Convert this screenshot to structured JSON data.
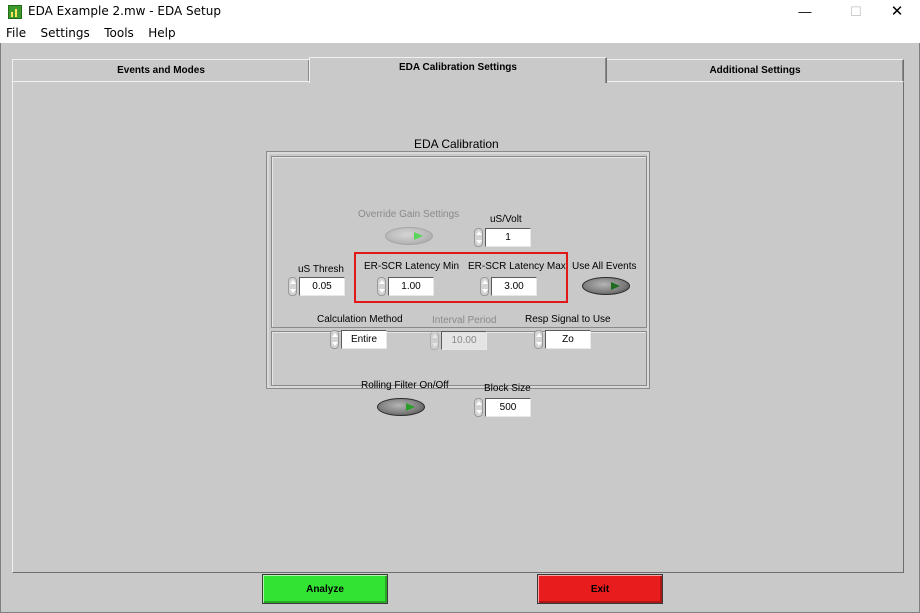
{
  "window": {
    "title": "EDA Example 2.mw - EDA Setup",
    "minimize": "—",
    "maximize": "☐",
    "close": "✕"
  },
  "menu": [
    "File",
    "Settings",
    "Tools",
    "Help"
  ],
  "tabs": [
    {
      "label": "Events and Modes",
      "selected": false
    },
    {
      "label": "EDA Calibration Settings",
      "selected": true
    },
    {
      "label": "Additional Settings",
      "selected": false
    }
  ],
  "calibration": {
    "title": "EDA Calibration",
    "override_gain": {
      "label": "Override Gain Settings",
      "enabled": false,
      "state": "on"
    },
    "us_volt": {
      "label": "uS/Volt",
      "value": "1"
    },
    "us_thresh": {
      "label": "uS Thresh",
      "value": "0.05"
    },
    "latency_min": {
      "label": "ER-SCR Latency Min",
      "value": "1.00"
    },
    "latency_max": {
      "label": "ER-SCR Latency Max",
      "value": "3.00"
    },
    "use_all_events": {
      "label": "Use All Events",
      "state": "on"
    },
    "calc_method": {
      "label": "Calculation  Method",
      "value": "Entire"
    },
    "interval_period": {
      "label": "Interval Period",
      "value": "10.00",
      "enabled": false
    },
    "resp_signal": {
      "label": "Resp Signal to Use",
      "value": "Zo"
    },
    "rolling_filter": {
      "label": "Rolling Filter On/Off",
      "state": "on"
    },
    "block_size": {
      "label": "Block Size",
      "value": "500"
    }
  },
  "buttons": {
    "analyze": "Analyze",
    "exit": "Exit"
  },
  "colors": {
    "panel_bg": "#c9c9c9",
    "analyze_bg": "#33e333",
    "exit_bg": "#e81c1c",
    "highlight": "#e01818"
  }
}
